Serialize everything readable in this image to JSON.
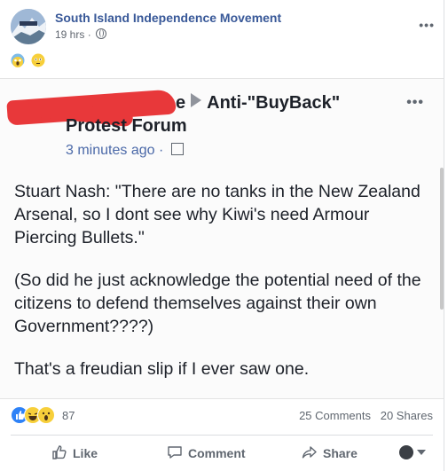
{
  "page": {
    "name": "South Island Independence Movement",
    "time": "19 hrs",
    "separator": "·",
    "reaction_emojis": [
      "scream-emoji",
      "flushed-emoji"
    ]
  },
  "shared_post": {
    "source_suffix": "e",
    "group_name": "Anti-\"BuyBack\"",
    "group_name_line2": "Protest Forum",
    "time": "3 minutes ago",
    "separator": "·",
    "paragraphs": [
      "Stuart Nash: \"There are no tanks in the New Zealand Arsenal, so I dont see why Kiwi's need Armour Piercing Bullets.\"",
      "(So did he just acknowledge the potential need of the citizens to defend themselves against their own Government????)",
      "That's a freudian slip if I ever saw one."
    ]
  },
  "stats": {
    "reactions_count": "87",
    "comments": "25 Comments",
    "shares": "20 Shares",
    "reaction_types": [
      "like",
      "haha",
      "wow"
    ]
  },
  "actions": {
    "like": "Like",
    "comment": "Comment",
    "share": "Share"
  },
  "colors": {
    "link_blue": "#385898",
    "redaction_red": "#e8383a"
  }
}
